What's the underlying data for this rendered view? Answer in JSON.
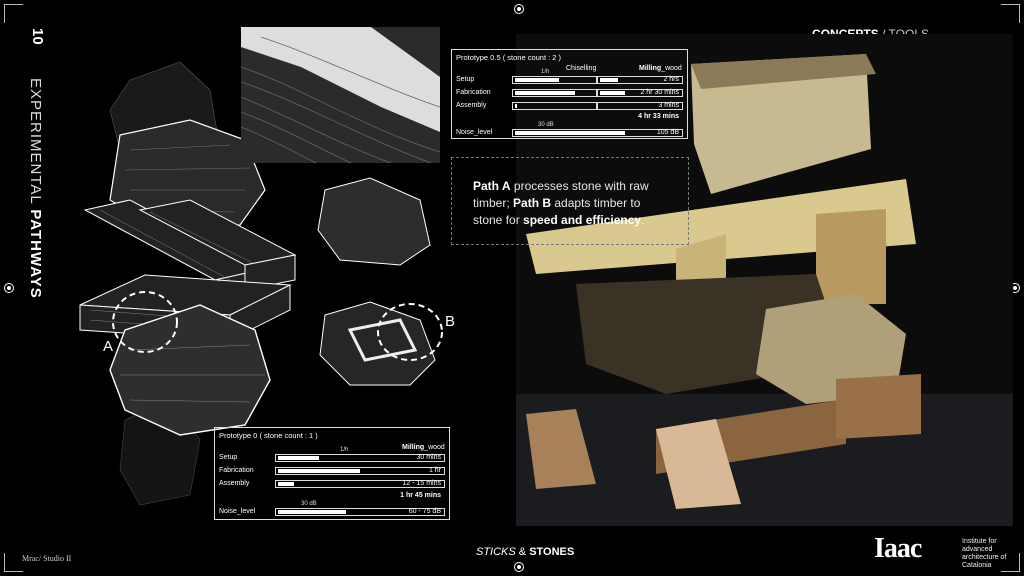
{
  "page": {
    "number": "10"
  },
  "vertical_title": {
    "light": "EXPERIMENTAL ",
    "bold": "PATHWAYS"
  },
  "header": {
    "section": "CONCEPTS",
    "separator": " / ",
    "subsection": "TOOLS"
  },
  "footer": {
    "left": "Mrac/ Studio II",
    "center_italic": "STICKS",
    "center_amp": " & ",
    "center_bold": "STONES"
  },
  "logo": {
    "mark": "Iaac",
    "text": "Institute for advanced architecture of Catalonia"
  },
  "labels": {
    "a": "A",
    "b": "B"
  },
  "callout": {
    "path_a": "Path A",
    "text1": " processes stone with raw timber; ",
    "path_b": "Path B",
    "text2": " adapts timber to stone for ",
    "emph": "speed and efficiency",
    "end": "."
  },
  "table_top": {
    "title": "Prototype 0.5 ( stone count :  2 )",
    "col1": "Chiselling",
    "col2_b": "Milling",
    "col2_l": "_wood",
    "tick_1h": "1/h",
    "rows": [
      {
        "label": "Setup",
        "value": "2 hrs",
        "a": 0.55,
        "b": 0.25
      },
      {
        "label": "Fabrication",
        "value": "2 hr 30 mins",
        "a": 0.75,
        "b": 0.35
      },
      {
        "label": "Assembly",
        "value": "3 mins",
        "a": 0.02,
        "b": 0
      }
    ],
    "total": "4 hr 33 mins",
    "noise_tick": "30 dB",
    "noise": {
      "label": "Noise_level",
      "value": "105 dB",
      "fill": 0.92
    }
  },
  "table_bottom": {
    "title": "Prototype 0 ( stone count :  1 )",
    "col2_b": "Milling",
    "col2_l": "_wood",
    "tick_1h": "1/h",
    "rows": [
      {
        "label": "Setup",
        "value": "30 mins",
        "a": 0.4
      },
      {
        "label": "Fabrication",
        "value": "1 hr",
        "a": 0.8
      },
      {
        "label": "Assembly",
        "value": "12 - 15 mins",
        "a": 0.16
      }
    ],
    "total": "1 hr 45 mins",
    "noise_tick": "30 dB",
    "noise": {
      "label": "Noise_level",
      "value": "60 - 75 dB",
      "fill": 0.4
    }
  },
  "colors": {
    "bg": "#000000",
    "wood": "#d9c98e",
    "stone": "#b8a97e"
  }
}
